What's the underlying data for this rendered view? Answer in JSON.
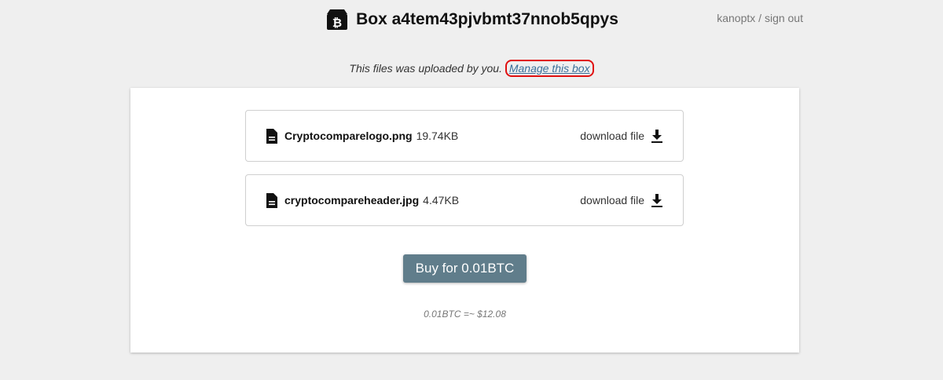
{
  "header": {
    "title": "Box a4tem43pjvbmt37nnob5qpys",
    "icon": "bitcoin-box-icon"
  },
  "user": {
    "username": "kanoptx",
    "separator": " / ",
    "signout_label": "sign out"
  },
  "notice": {
    "text": "This files was uploaded by you. ",
    "manage_link": "Manage this box"
  },
  "files": [
    {
      "name": "Cryptocomparelogo.png",
      "size": "19.74KB",
      "download_label": "download file",
      "icon": "file-icon"
    },
    {
      "name": "cryptocompareheader.jpg",
      "size": "4.47KB",
      "download_label": "download file",
      "icon": "file-icon"
    }
  ],
  "purchase": {
    "button_label": "Buy for 0.01BTC",
    "conversion": "0.01BTC =~ $12.08"
  },
  "colors": {
    "background": "#efefef",
    "button": "#607d8b",
    "link": "#3a6f9a",
    "highlight": "#e01010"
  }
}
